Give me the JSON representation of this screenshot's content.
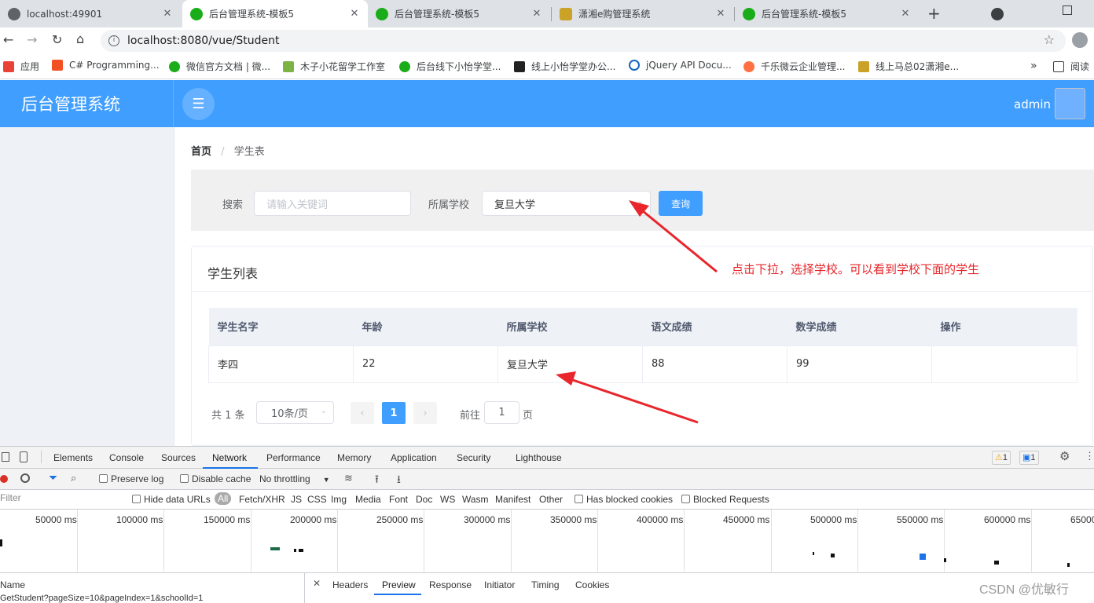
{
  "browser": {
    "tabs": [
      {
        "title": "localhost:49901"
      },
      {
        "title": "后台管理系统-模板5"
      },
      {
        "title": "后台管理系统-模板5"
      },
      {
        "title": "潇湘e购管理系统"
      },
      {
        "title": "后台管理系统-模板5"
      }
    ],
    "url": "localhost:8080/vue/Student",
    "bookmarks": [
      {
        "label": "应用"
      },
      {
        "label": "C# Programming..."
      },
      {
        "label": "微信官方文档 | 微..."
      },
      {
        "label": "木子小花留学工作室"
      },
      {
        "label": "后台线下小怡学堂..."
      },
      {
        "label": "线上小怡学堂办公..."
      },
      {
        "label": "jQuery API Docu..."
      },
      {
        "label": "千乐微云企业管理..."
      },
      {
        "label": "线上马总02潇湘e..."
      }
    ],
    "bookmarks_overflow": "»",
    "reading_list": "阅读"
  },
  "app": {
    "logo": "后台管理系统",
    "user": "admin",
    "breadcrumb": {
      "home": "首页",
      "sep": "/",
      "current": "学生表"
    },
    "search": {
      "label": "搜索",
      "placeholder": "请输入关键词",
      "school_label": "所属学校",
      "school_value": "复旦大学",
      "query_button": "查询"
    },
    "card_title": "学生列表",
    "table": {
      "headers": [
        "学生名字",
        "年龄",
        "所属学校",
        "语文成绩",
        "数学成绩",
        "操作"
      ],
      "rows": [
        [
          "李四",
          "22",
          "复旦大学",
          "88",
          "99",
          ""
        ]
      ]
    },
    "pagination": {
      "total": "共 1 条",
      "page_size": "10条/页",
      "current": "1",
      "goto_prefix": "前往",
      "goto_value": "1",
      "goto_suffix": "页"
    },
    "annotation": "点击下拉，选择学校。可以看到学校下面的学生"
  },
  "devtools": {
    "tabs": [
      "Elements",
      "Console",
      "Sources",
      "Network",
      "Performance",
      "Memory",
      "Application",
      "Security",
      "Lighthouse"
    ],
    "active_tab": "Network",
    "warnings": "1",
    "messages": "1",
    "toolbar": {
      "preserve_log": "Preserve log",
      "disable_cache": "Disable cache",
      "throttling": "No throttling"
    },
    "filter": {
      "placeholder": "Filter",
      "hide_data_urls": "Hide data URLs",
      "types": [
        "All",
        "Fetch/XHR",
        "JS",
        "CSS",
        "Img",
        "Media",
        "Font",
        "Doc",
        "WS",
        "Wasm",
        "Manifest",
        "Other"
      ],
      "has_blocked_cookies": "Has blocked cookies",
      "blocked_requests": "Blocked Requests"
    },
    "timeline_ticks": [
      "50000 ms",
      "100000 ms",
      "150000 ms",
      "200000 ms",
      "250000 ms",
      "300000 ms",
      "350000 ms",
      "400000 ms",
      "450000 ms",
      "500000 ms",
      "550000 ms",
      "600000 ms",
      "65000"
    ],
    "name_header": "Name",
    "request": "GetStudent?pageSize=10&pageIndex=1&schoolId=1",
    "detail_tabs": [
      "Headers",
      "Preview",
      "Response",
      "Initiator",
      "Timing",
      "Cookies"
    ],
    "detail_active": "Preview"
  },
  "watermark": "CSDN @优敏行",
  "colors": {
    "primary": "#409eff",
    "annotation": "#e5252a",
    "arrow": "#e8262b"
  }
}
